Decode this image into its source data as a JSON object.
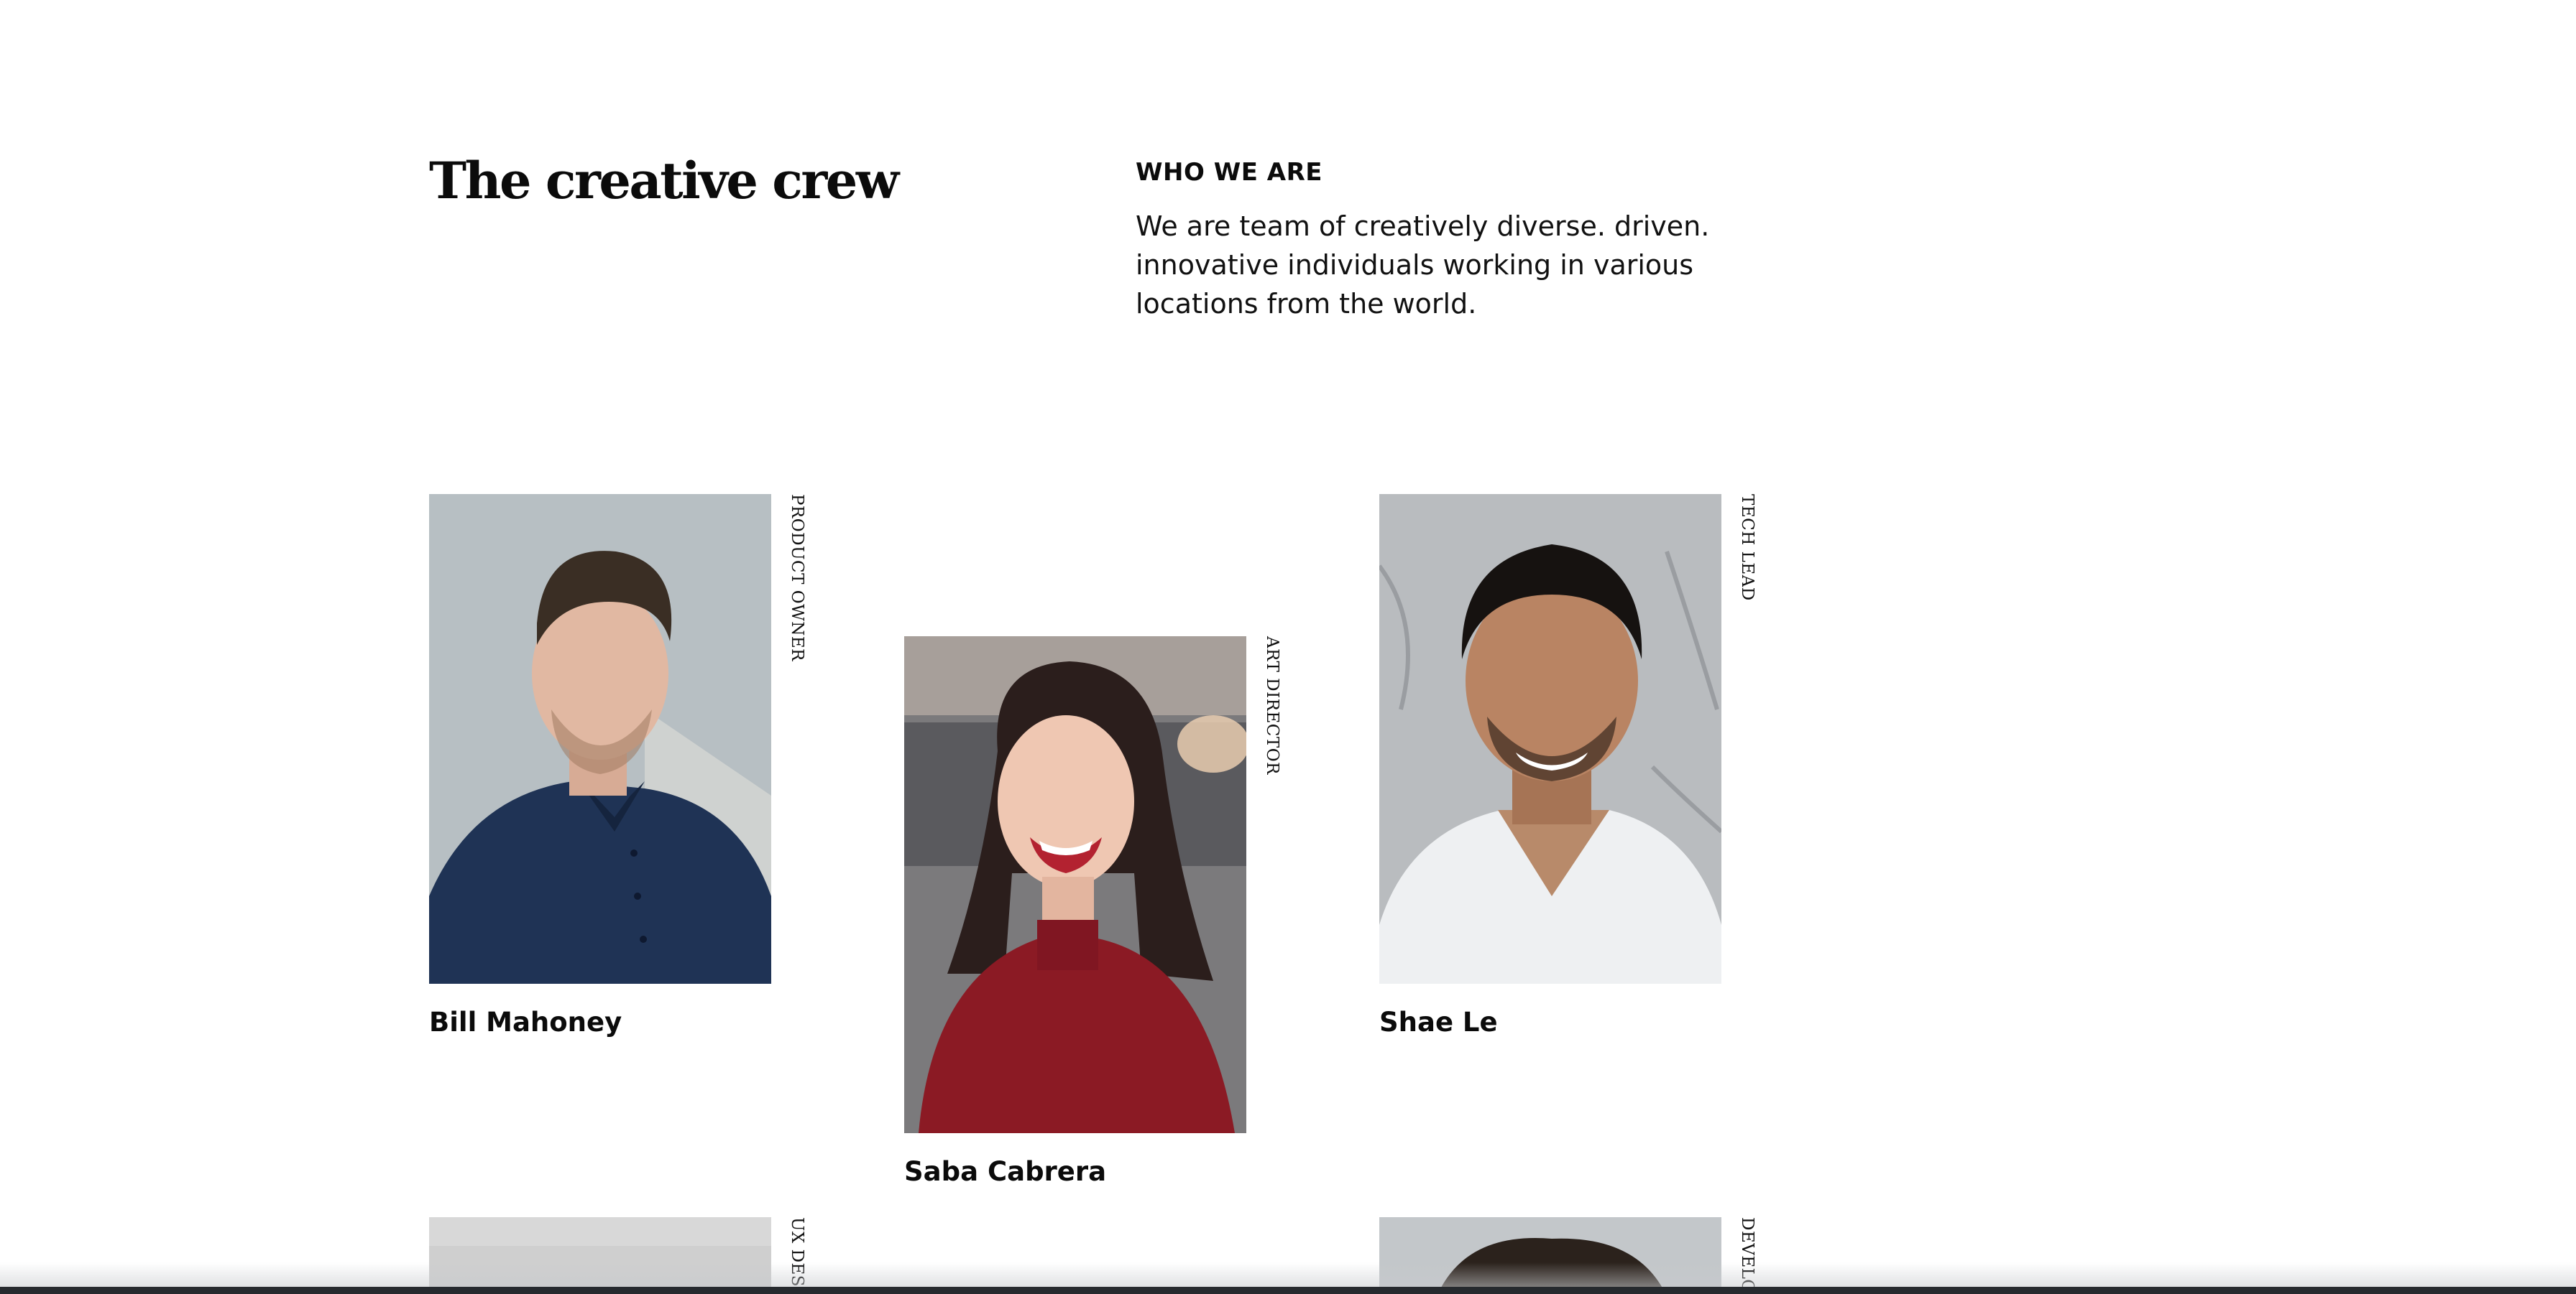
{
  "heading": {
    "title": "The creative crew",
    "eyebrow": "WHO WE ARE",
    "intro": "We are team of creatively diverse. driven. innovative individuals working in various locations from the world."
  },
  "members": [
    {
      "name": "Bill Mahoney",
      "role": "PRODUCT OWNER",
      "photo": "portrait-man-navy-polo"
    },
    {
      "name": "Saba Cabrera",
      "role": "ART DIRECTOR",
      "photo": "portrait-woman-red-sweater"
    },
    {
      "name": "Shae Le",
      "role": "TECH LEAD",
      "photo": "portrait-man-white-tshirt"
    },
    {
      "name": "",
      "role": "UX DESIG",
      "photo": "portrait-partial-grey"
    },
    {
      "name": "",
      "role": "DEVELO",
      "photo": "portrait-partial-man"
    }
  ],
  "colors": {
    "text": "#0b0b0b",
    "background": "#ffffff",
    "bill_shirt": "#1f3355",
    "saba_sweater": "#8b1a24",
    "shae_background": "#b9bcbf"
  }
}
